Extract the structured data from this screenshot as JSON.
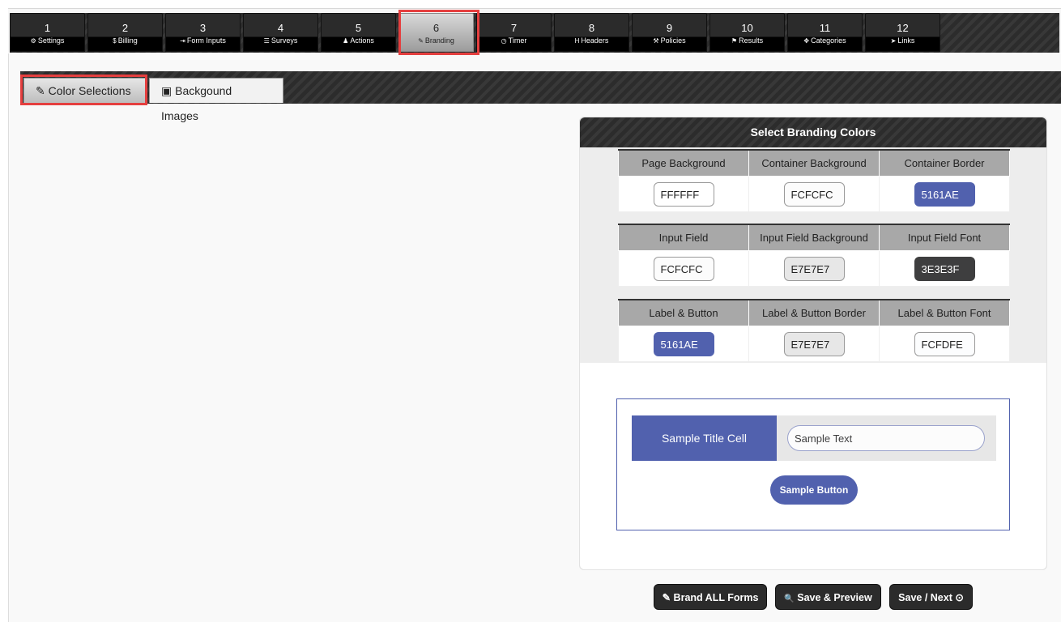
{
  "steps": [
    {
      "num": "1",
      "label": "Settings",
      "icon": "⚙"
    },
    {
      "num": "2",
      "label": "Billing",
      "icon": "$"
    },
    {
      "num": "3",
      "label": "Form Inputs",
      "icon": "⇥"
    },
    {
      "num": "4",
      "label": "Surveys",
      "icon": "☰"
    },
    {
      "num": "5",
      "label": "Actions",
      "icon": "♟"
    },
    {
      "num": "6",
      "label": "Branding",
      "icon": "✎"
    },
    {
      "num": "7",
      "label": "Timer",
      "icon": "◷"
    },
    {
      "num": "8",
      "label": "Headers",
      "icon": "H"
    },
    {
      "num": "9",
      "label": "Policies",
      "icon": "⚒"
    },
    {
      "num": "10",
      "label": "Results",
      "icon": "⚑"
    },
    {
      "num": "11",
      "label": "Categories",
      "icon": "✥"
    },
    {
      "num": "12",
      "label": "Links",
      "icon": "➤"
    }
  ],
  "active_step": "6",
  "subtabs": {
    "colors": {
      "label": "Color Selections",
      "icon": "✎"
    },
    "images": {
      "label": "Backgound Images",
      "icon": "▣"
    }
  },
  "branding": {
    "title": "Select Branding Colors",
    "groups": [
      {
        "fields": [
          {
            "label": "Page Background",
            "value": "FFFFFF",
            "bg": "#FFFFFF",
            "fg": "#222222"
          },
          {
            "label": "Container Background",
            "value": "FCFCFC",
            "bg": "#FCFCFC",
            "fg": "#222222"
          },
          {
            "label": "Container Border",
            "value": "5161AE",
            "bg": "#5161AE",
            "fg": "#FFFFFF"
          }
        ]
      },
      {
        "fields": [
          {
            "label": "Input Field",
            "value": "FCFCFC",
            "bg": "#FCFCFC",
            "fg": "#222222"
          },
          {
            "label": "Input Field Background",
            "value": "E7E7E7",
            "bg": "#E7E7E7",
            "fg": "#222222"
          },
          {
            "label": "Input Field Font",
            "value": "3E3E3F",
            "bg": "#3E3E3F",
            "fg": "#FFFFFF"
          }
        ]
      },
      {
        "fields": [
          {
            "label": "Label & Button",
            "value": "5161AE",
            "bg": "#5161AE",
            "fg": "#FFFFFF"
          },
          {
            "label": "Label & Button Border",
            "value": "E7E7E7",
            "bg": "#E7E7E7",
            "fg": "#222222"
          },
          {
            "label": "Label & Button Font",
            "value": "FCFDFE",
            "bg": "#FCFDFE",
            "fg": "#222222"
          }
        ]
      }
    ],
    "sample": {
      "title_cell": "Sample Title Cell",
      "text": "Sample Text",
      "button": "Sample Button"
    }
  },
  "actions": {
    "brand_all": {
      "label": "Brand ALL Forms",
      "icon": "✎"
    },
    "save_preview": {
      "label": "Save & Preview",
      "icon": "🔍"
    },
    "save_next": {
      "label": "Save / Next",
      "icon": "⊙"
    }
  },
  "colors": {
    "accent": "#5161AE",
    "highlight": "#E53F3F",
    "dark": "#2B2B2B"
  }
}
